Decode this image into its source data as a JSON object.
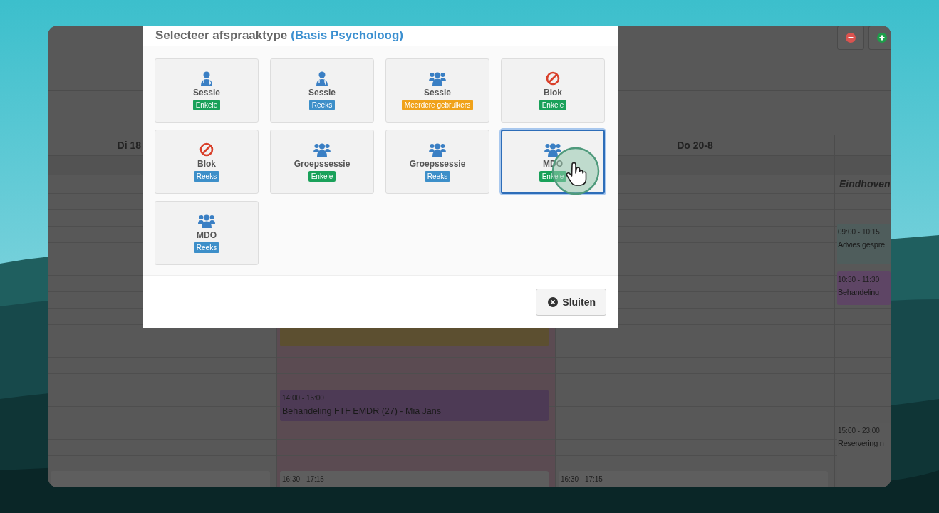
{
  "toolbar": {
    "buttons": [
      {
        "kind": "minus"
      },
      {
        "kind": "plus"
      }
    ]
  },
  "calendar": {
    "columns": [
      {
        "header": "Di 18",
        "events": [
          {
            "color": "#5e5e5e"
          }
        ]
      },
      {
        "events": [
          {
            "color": "#5c4f30"
          },
          {
            "time": "14:00 - 15:00",
            "title": "Behandeling FTF EMDR (27) - Mia Jans",
            "color": "#4d3a55"
          },
          {
            "time": "16:30 - 17:15",
            "color": "#5e5e5e"
          }
        ]
      },
      {
        "header": "Do 20-8",
        "events": [
          {
            "time": "16:30 - 17:15",
            "color": "#5e5e5e"
          }
        ]
      },
      {
        "subheader": "Eindhoven",
        "events": [
          {
            "time": "09:00 - 10:15",
            "title": "Advies gespre",
            "color": "#4f5d5c"
          },
          {
            "time": "10:30 - 11:30",
            "title": "Behandeling",
            "color": "#5e4565"
          },
          {
            "time": "15:00 - 23:00",
            "title": "Reservering n",
            "color": "#595959"
          }
        ]
      }
    ]
  },
  "modal": {
    "title": "Selecteer afspraaktype",
    "title_context": "(Basis Psycholoog)",
    "types": [
      {
        "kind": "person",
        "label": "Sessie",
        "tag": "Enkele",
        "color": "#1aa15a",
        "selected": false
      },
      {
        "kind": "person",
        "label": "Sessie",
        "tag": "Reeks",
        "color": "#3d8fc9",
        "selected": false
      },
      {
        "kind": "group",
        "label": "Sessie",
        "tag": "Meerdere gebruikers",
        "color": "#f0a21a",
        "selected": false
      },
      {
        "kind": "block",
        "label": "Blok",
        "tag": "Enkele",
        "color": "#1aa15a",
        "selected": false
      },
      {
        "kind": "block",
        "label": "Blok",
        "tag": "Reeks",
        "color": "#3d8fc9",
        "selected": false
      },
      {
        "kind": "group",
        "label": "Groepssessie",
        "tag": "Enkele",
        "color": "#1aa15a",
        "selected": false
      },
      {
        "kind": "group",
        "label": "Groepssessie",
        "tag": "Reeks",
        "color": "#3d8fc9",
        "selected": false
      },
      {
        "kind": "group",
        "label": "MDO",
        "tag": "Enkele",
        "color": "#1aa15a",
        "selected": true
      },
      {
        "kind": "group",
        "label": "MDO",
        "tag": "Reeks",
        "color": "#3d8fc9",
        "selected": false
      }
    ],
    "close_button": "Sluiten"
  }
}
